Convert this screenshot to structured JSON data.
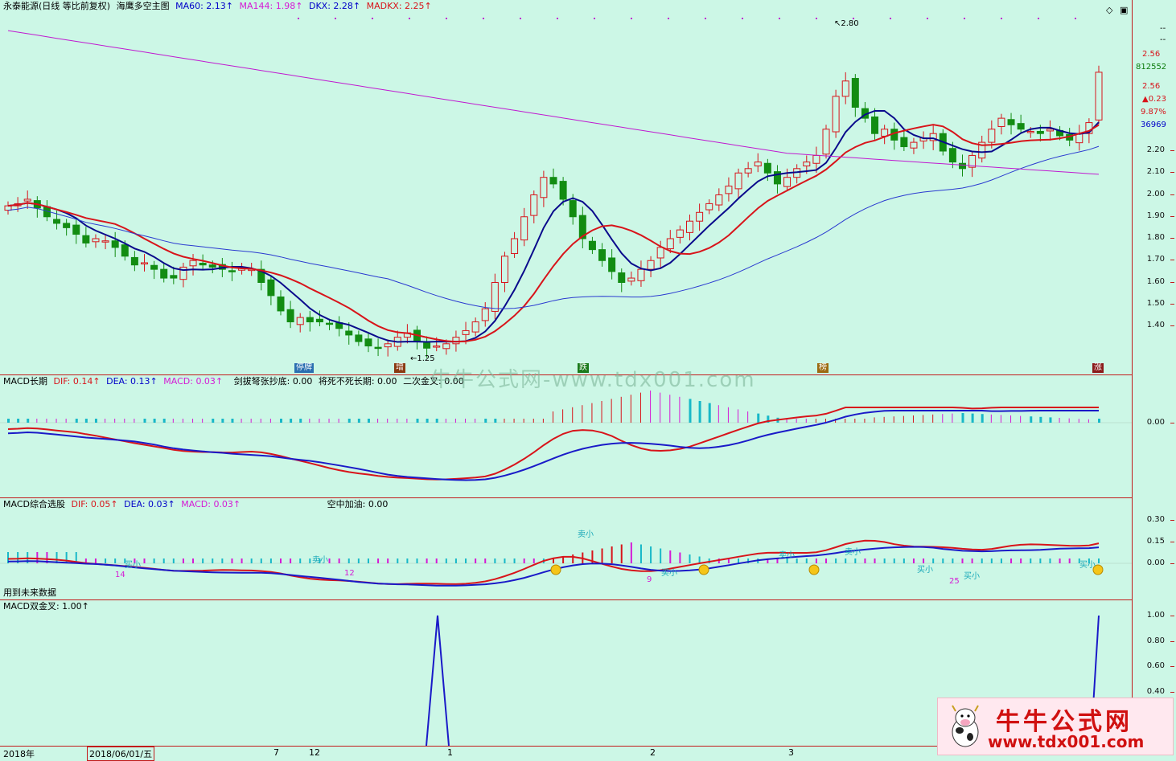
{
  "main_pane": {
    "title": "永泰能源(日线 等比前复权)",
    "indicator": "海鹰多空主图",
    "ma60": "MA60: 2.13↑",
    "ma144": "MA144: 1.98↑",
    "dkx": "DKX: 2.28↑",
    "madkx": "MADKX: 2.25↑",
    "high_label": "2.80",
    "low_label": "1.25",
    "axis_ticks": [
      "2.20",
      "2.10",
      "2.00",
      "1.90",
      "1.80",
      "1.70",
      "1.60",
      "1.50",
      "1.40"
    ],
    "right_info": [
      "--",
      "--",
      "2.56",
      "812552",
      "2.56",
      "▲0.23",
      "9.87%",
      "36969"
    ],
    "event_tags": [
      "停牌",
      "增",
      "跌",
      "榜",
      "涨"
    ]
  },
  "macd_long": {
    "name": "MACD长期",
    "dif": "DIF: 0.14↑",
    "dea": "DEA: 0.13↑",
    "macd": "MACD: 0.03↑",
    "extra1": "剑拔弩张抄底: 0.00",
    "extra2": "将死不死长期: 0.00",
    "extra3": "二次金叉: 0.00",
    "axis_ticks": [
      "0.00"
    ]
  },
  "macd_combo": {
    "name": "MACD综合选股",
    "dif": "DIF: 0.05↑",
    "dea": "DEA: 0.03↑",
    "macd": "MACD: 0.03↑",
    "extra": "空中加油: 0.00",
    "future_note": "用到未来数据",
    "axis_ticks": [
      "0.30",
      "0.15",
      "0.00"
    ],
    "labels": [
      "买小",
      "卖小",
      "14",
      "12",
      "9",
      "25"
    ]
  },
  "macd_double": {
    "name": "MACD双金叉",
    "value": ": 1.00↑",
    "axis_ticks": [
      "1.00",
      "0.80",
      "0.60",
      "0.40"
    ]
  },
  "bottom_axis": [
    "2018年",
    "2018/06/01/五",
    "7",
    "12",
    "1",
    "2",
    "3"
  ],
  "watermark": "牛牛公式网-www.tdx001.com",
  "logo": {
    "title": "牛牛公式网",
    "url": "www.tdx001.com"
  },
  "colors": {
    "background": "#ccf7e6",
    "up": "#d8141a",
    "down": "#128c12",
    "dkx": "#0a0a8c",
    "madkx": "#d8141a"
  },
  "chart_data": {
    "type": "candlestick",
    "closes": [
      1.95,
      1.96,
      1.98,
      1.94,
      1.9,
      1.87,
      1.85,
      1.82,
      1.78,
      1.8,
      1.79,
      1.76,
      1.72,
      1.68,
      1.69,
      1.66,
      1.62,
      1.62,
      1.67,
      1.7,
      1.68,
      1.67,
      1.66,
      1.65,
      1.67,
      1.66,
      1.6,
      1.54,
      1.47,
      1.42,
      1.44,
      1.42,
      1.42,
      1.41,
      1.39,
      1.36,
      1.33,
      1.31,
      1.3,
      1.32,
      1.35,
      1.37,
      1.33,
      1.3,
      1.31,
      1.32,
      1.35,
      1.38,
      1.42,
      1.48,
      1.6,
      1.72,
      1.8,
      1.9,
      2.0,
      2.08,
      2.05,
      1.98,
      1.9,
      1.8,
      1.75,
      1.7,
      1.65,
      1.6,
      1.62,
      1.66,
      1.7,
      1.76,
      1.8,
      1.84,
      1.88,
      1.92,
      1.96,
      2.0,
      2.04,
      2.1,
      2.12,
      2.15,
      2.1,
      2.05,
      2.08,
      2.12,
      2.15,
      2.18,
      2.3,
      2.45,
      2.52,
      2.4,
      2.35,
      2.28,
      2.3,
      2.25,
      2.22,
      2.24,
      2.26,
      2.28,
      2.2,
      2.15,
      2.12,
      2.18,
      2.24,
      2.3,
      2.35,
      2.32,
      2.3,
      2.29,
      2.28,
      2.3,
      2.27,
      2.25,
      2.28,
      2.33,
      2.56
    ]
  }
}
